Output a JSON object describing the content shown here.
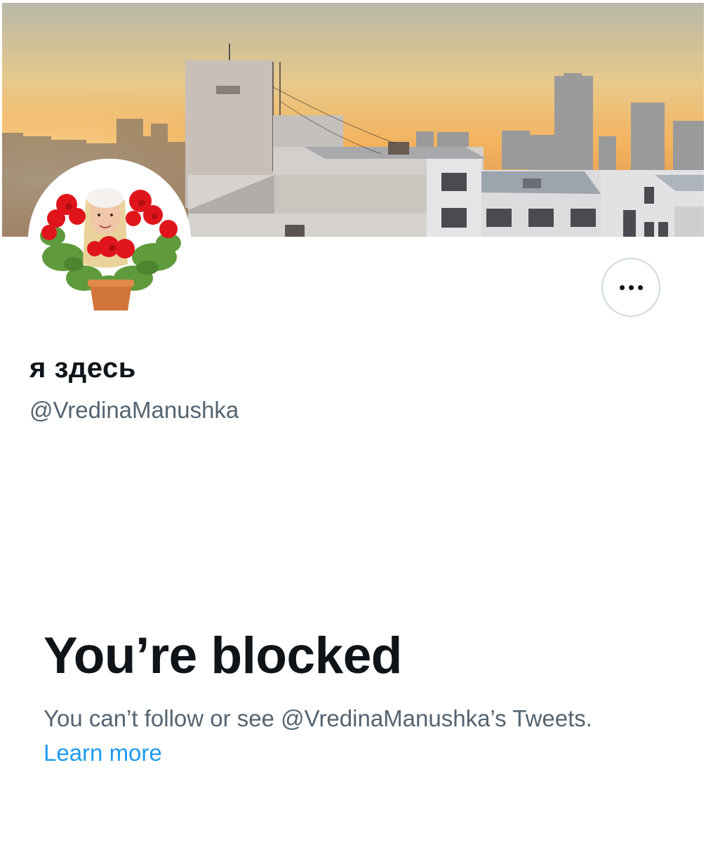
{
  "profile": {
    "display_name": "я здесь",
    "handle": "@VredinaManushka"
  },
  "banner": {
    "description_icon": "banner-image"
  },
  "actions": {
    "more_icon": "more-dots-icon"
  },
  "blocked": {
    "title": "You’re blocked",
    "description": "You can’t follow or see @VredinaManushka’s Tweets.",
    "learn_more": "Learn more"
  },
  "colors": {
    "text_primary": "#0f1419",
    "text_secondary": "#536471",
    "link": "#1d9bf0",
    "border": "#cfd9de"
  }
}
